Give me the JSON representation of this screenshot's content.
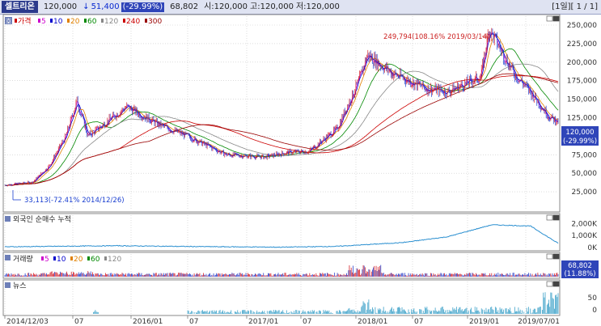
{
  "header": {
    "stock_name": "셀트리온",
    "price": "120,000",
    "down_arrow": "↓",
    "change": "51,400",
    "change_pct": "(-29.99%)",
    "volume": "68,802",
    "open": "시:120,000",
    "high": "고:120,000",
    "low": "저:120,000",
    "period_info": "[1일][ 1 / 1]"
  },
  "price_panel": {
    "badge": "호",
    "legend": [
      {
        "label": "가격",
        "color": "#cc0000"
      },
      {
        "label": "5",
        "color": "#cc00cc"
      },
      {
        "label": "10",
        "color": "#0000cc"
      },
      {
        "label": "20",
        "color": "#e08000"
      },
      {
        "label": "60",
        "color": "#008800"
      },
      {
        "label": "120",
        "color": "#888888"
      },
      {
        "label": "240",
        "color": "#cc0000"
      },
      {
        "label": "300",
        "color": "#990000"
      }
    ],
    "y_ticks": [
      "250,000",
      "225,000",
      "200,000",
      "175,000",
      "150,000",
      "125,000",
      "100,000",
      "75,000",
      "50,000",
      "25,000"
    ],
    "current_price": "120,000",
    "current_pct": "(-29.99%)",
    "max_annotation": "249,794(108.16% 2019/03/14)",
    "min_annotation": "33,113(-72.41% 2014/12/26)"
  },
  "foreign_panel": {
    "title": "외국인 순매수 누적",
    "y_ticks": [
      "2,000K",
      "1,000K",
      "0K"
    ]
  },
  "volume_panel": {
    "legend": [
      {
        "label": "거래량",
        "color": "#cc0000"
      },
      {
        "label": "5",
        "color": "#cc00cc"
      },
      {
        "label": "10",
        "color": "#0000cc"
      },
      {
        "label": "20",
        "color": "#e08000"
      },
      {
        "label": "60",
        "color": "#008800"
      },
      {
        "label": "120",
        "color": "#888888"
      }
    ],
    "value": "68,802",
    "value_pct": "(11.88%)"
  },
  "news_panel": {
    "title": "뉴스",
    "y_ticks": [
      "50",
      "0"
    ]
  },
  "x_axis": {
    "labels": [
      "2014/12/03",
      "07",
      "2016/01",
      "07",
      "2017/01",
      "07",
      "2018/01",
      "07",
      "2019/01",
      "2019/07/01"
    ]
  },
  "colors": {
    "up": "#d4202a",
    "down": "#1f3fd0",
    "panel_bg": "#ffffff",
    "header_bg": "#dfe3f2",
    "grid": "#c8c8c8",
    "volume_bar": "#2a3fc9",
    "news_bar": "#3aa0c8",
    "foreign_line": "#2a8fd0"
  },
  "chart_data": [
    {
      "type": "line",
      "title": "",
      "xlabel": "",
      "ylabel": "",
      "x": [
        "2014/12/03",
        "2015/03",
        "2015/05",
        "2015/07",
        "2015/08",
        "2015/10",
        "2016/01",
        "2016/04",
        "2016/07",
        "2016/10",
        "2017/01",
        "2017/04",
        "2017/07",
        "2017/10",
        "2018/01",
        "2018/02",
        "2018/04",
        "2018/07",
        "2018/10",
        "2019/01",
        "2019/03",
        "2019/05",
        "2019/06",
        "2019/07",
        "2019/07/01"
      ],
      "series": [
        {
          "name": "가격",
          "values": [
            34000,
            38000,
            60000,
            100000,
            148000,
            100000,
            140000,
            115000,
            100000,
            75000,
            72000,
            78000,
            80000,
            110000,
            175000,
            210000,
            185000,
            165000,
            160000,
            180000,
            245000,
            185000,
            155000,
            125000,
            120000
          ]
        }
      ],
      "y_ticks": [
        25000,
        50000,
        75000,
        100000,
        125000,
        150000,
        175000,
        200000,
        225000,
        250000
      ],
      "ylim": [
        0,
        262000
      ],
      "grid": true
    }
  ]
}
